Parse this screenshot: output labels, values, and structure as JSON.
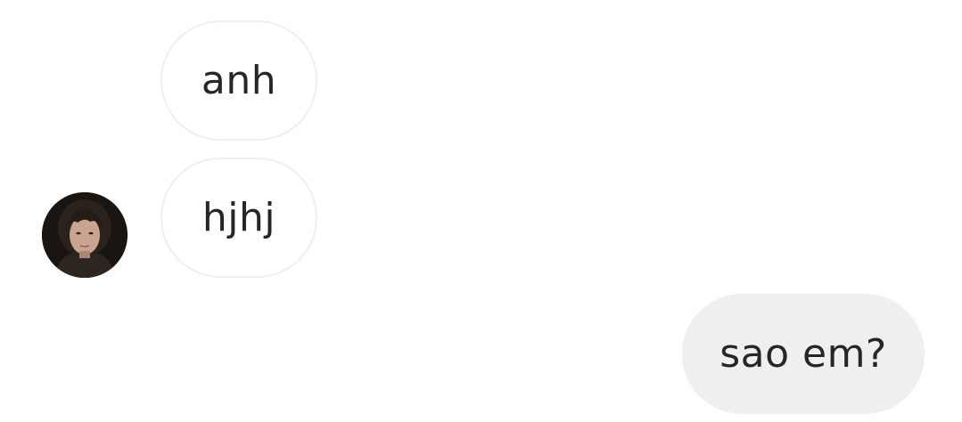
{
  "conversation": {
    "messages": [
      {
        "direction": "incoming",
        "text": "anh"
      },
      {
        "direction": "incoming",
        "text": "hjhj"
      },
      {
        "direction": "outgoing",
        "text": "sao em?"
      }
    ],
    "contact": {
      "avatar_icon": "profile-photo"
    }
  },
  "colors": {
    "incoming_bubble_bg": "#ffffff",
    "incoming_bubble_border": "#efefef",
    "outgoing_bubble_bg": "#efefef",
    "text": "#262626"
  }
}
